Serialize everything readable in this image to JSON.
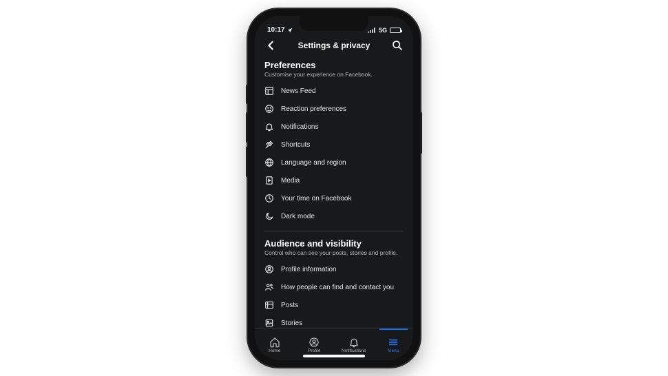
{
  "status": {
    "time": "10:17",
    "network": "5G"
  },
  "header": {
    "title": "Settings & privacy"
  },
  "sections": [
    {
      "title": "Preferences",
      "subtitle": "Customise your experience on Facebook.",
      "items": [
        {
          "icon": "feed-icon",
          "label": "News Feed"
        },
        {
          "icon": "reaction-icon",
          "label": "Reaction preferences"
        },
        {
          "icon": "bell-icon",
          "label": "Notifications"
        },
        {
          "icon": "pin-icon",
          "label": "Shortcuts"
        },
        {
          "icon": "globe-icon",
          "label": "Language and region"
        },
        {
          "icon": "media-icon",
          "label": "Media"
        },
        {
          "icon": "clock-icon",
          "label": "Your time on Facebook"
        },
        {
          "icon": "moon-icon",
          "label": "Dark mode"
        }
      ]
    },
    {
      "title": "Audience and visibility",
      "subtitle": "Control who can see your posts, stories and profile.",
      "items": [
        {
          "icon": "profile-circle-icon",
          "label": "Profile information"
        },
        {
          "icon": "people-icon",
          "label": "How people can find and contact you"
        },
        {
          "icon": "posts-icon",
          "label": "Posts"
        },
        {
          "icon": "stories-icon",
          "label": "Stories"
        }
      ]
    }
  ],
  "tabs": [
    {
      "icon": "home-icon",
      "label": "Home",
      "active": false
    },
    {
      "icon": "profile-icon",
      "label": "Profile",
      "active": false
    },
    {
      "icon": "bell-icon",
      "label": "Notifications",
      "active": false
    },
    {
      "icon": "menu-icon",
      "label": "Menu",
      "active": true
    }
  ]
}
